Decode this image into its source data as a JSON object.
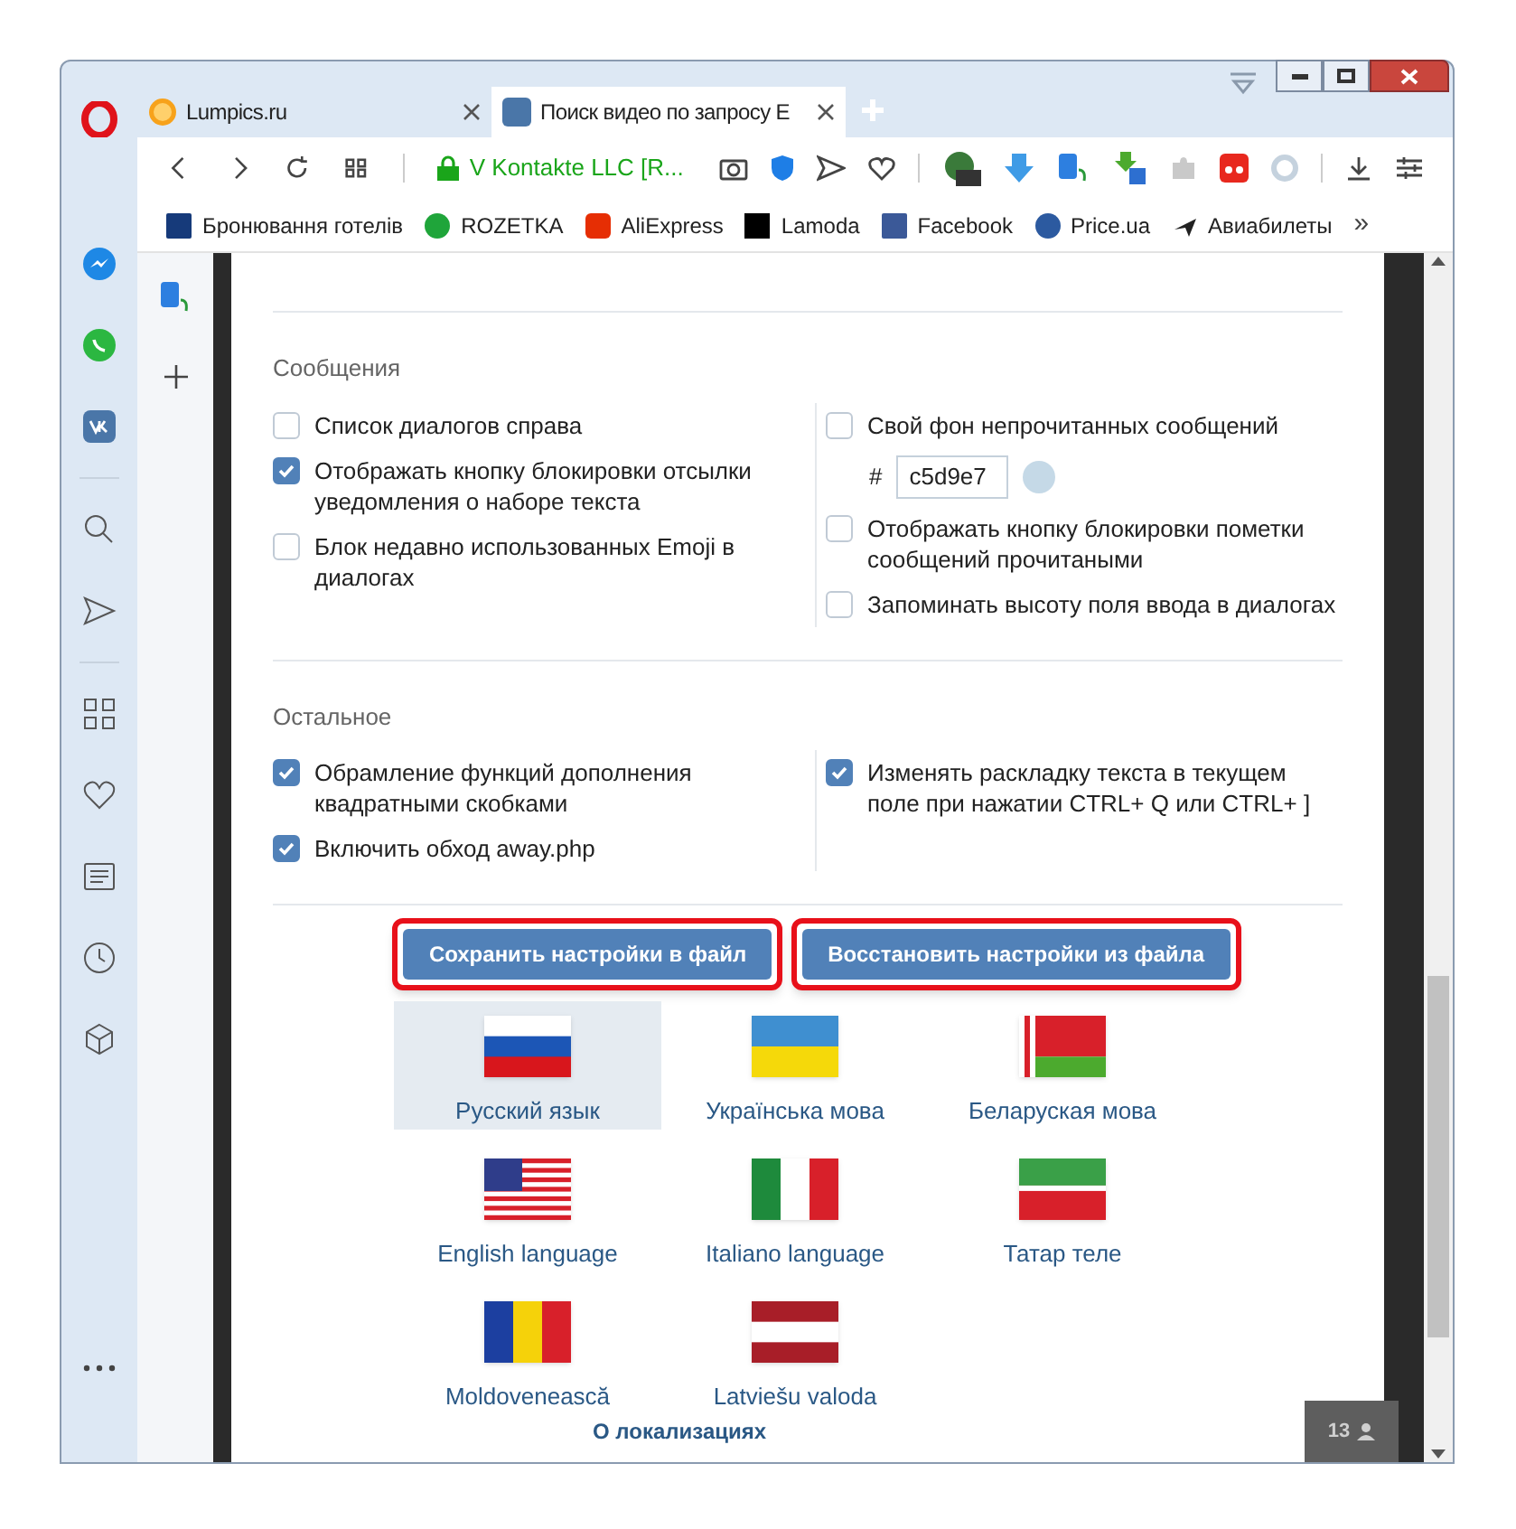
{
  "tabs": [
    {
      "title": "Lumpics.ru",
      "selected": false
    },
    {
      "title": "Поиск видео по запросу E",
      "selected": true
    }
  ],
  "address": {
    "text": "V Kontakte LLC [R..."
  },
  "bookmarks": [
    "Бронювання готелів",
    "ROZETKA",
    "AliExpress",
    "Lamoda",
    "Facebook",
    "Price.ua",
    "Авиабилеты"
  ],
  "bookmarks_more": "»",
  "sections": [
    {
      "title": "Сообщения",
      "left": [
        {
          "kind": "checkbox",
          "label": "Список диалогов справа",
          "checked": false
        },
        {
          "kind": "checkbox",
          "label": "Отображать кнопку блокировки отсылки уведомления о наборе текста",
          "checked": true
        },
        {
          "kind": "checkbox",
          "label": "Блок недавно использованных Emoji в диалогах",
          "checked": false
        }
      ],
      "right": [
        {
          "kind": "checkbox",
          "label": "Свой фон непрочитанных сообщений",
          "checked": false
        },
        {
          "kind": "color",
          "prefix": "#",
          "value": "c5d9e7",
          "color": "#c5d9e7"
        },
        {
          "kind": "checkbox",
          "label": "Отображать кнопку блокировки пометки сообщений прочитаными",
          "checked": false
        },
        {
          "kind": "checkbox",
          "label": "Запоминать высоту поля ввода в диалогах",
          "checked": false
        }
      ]
    },
    {
      "title": "Остальное",
      "left": [
        {
          "kind": "checkbox",
          "label": "Обрамление функций дополнения квадратными скобками",
          "checked": true
        },
        {
          "kind": "checkbox",
          "label": "Включить обход away.php",
          "checked": true
        }
      ],
      "right": [
        {
          "kind": "checkbox",
          "label": "Изменять раскладку текста в текущем поле при нажатии CTRL+ Q или CTRL+ ]",
          "checked": true
        }
      ]
    }
  ],
  "buttons": [
    "Сохранить настройки в файл",
    "Восстановить настройки из файла"
  ],
  "languages": [
    {
      "label": "Русский язык",
      "selected": true
    },
    {
      "label": "Українська мова",
      "selected": false
    },
    {
      "label": "Беларуская мова",
      "selected": false
    },
    {
      "label": "English language",
      "selected": false
    },
    {
      "label": "Italiano language",
      "selected": false
    },
    {
      "label": "Татар теле",
      "selected": false
    },
    {
      "label": "Moldovenească",
      "selected": false
    },
    {
      "label": "Latviešu valoda",
      "selected": false
    }
  ],
  "about_link": "О локализациях",
  "online_badge": "13"
}
